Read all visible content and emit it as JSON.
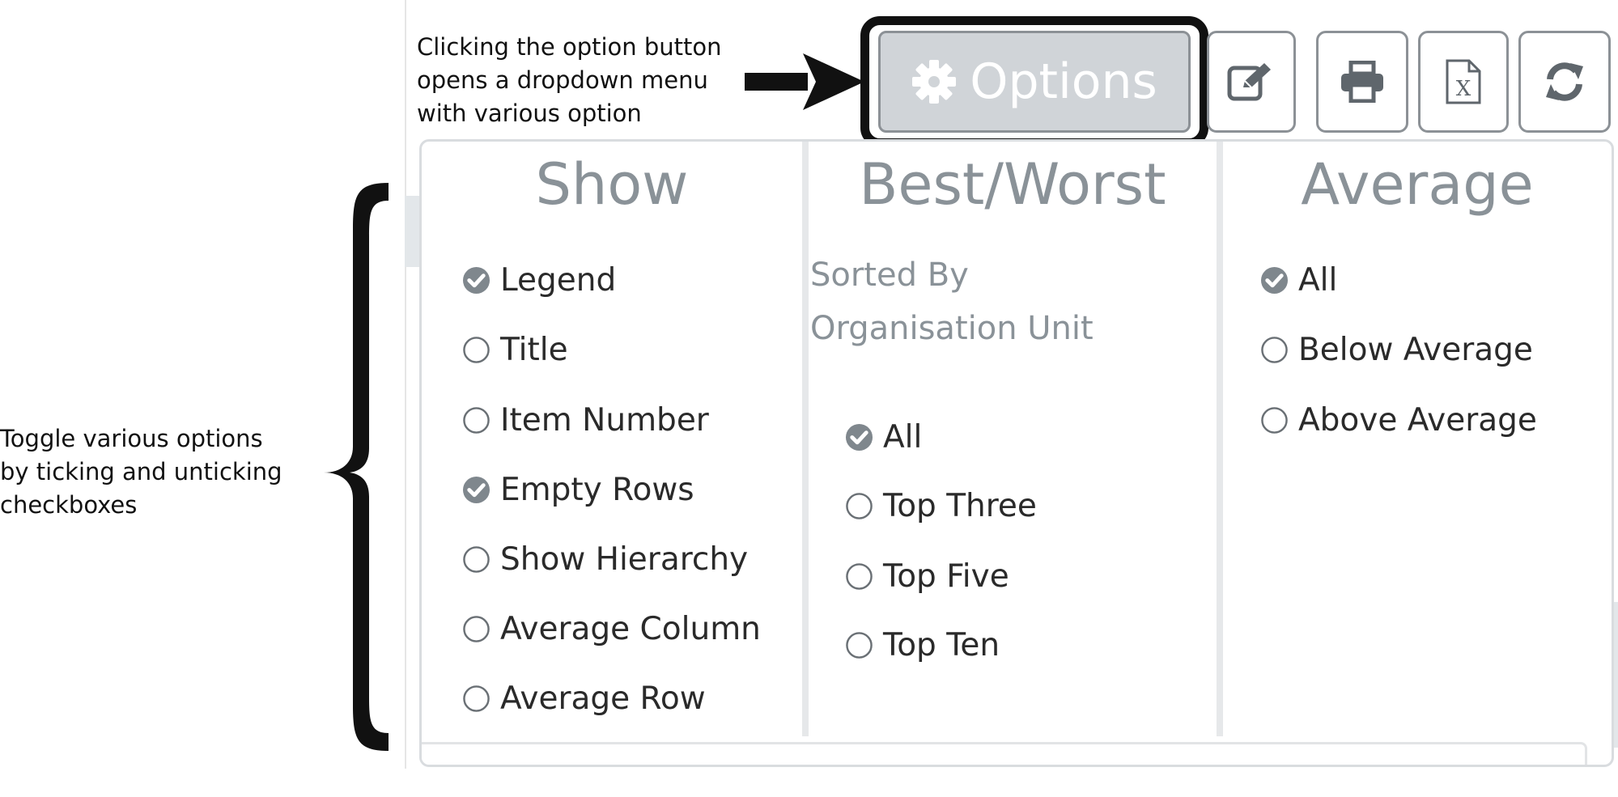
{
  "annotations": {
    "top": [
      "Clicking the option button",
      "opens a dropdown menu",
      "with various option"
    ],
    "left": [
      "Toggle various options",
      "by ticking and unticking",
      "checkboxes"
    ]
  },
  "toolbar": {
    "options_label": "Options",
    "options_icon": "gear-icon",
    "buttons": [
      {
        "name": "edit",
        "icon": "pencil-square-icon"
      },
      {
        "name": "print",
        "icon": "printer-icon"
      },
      {
        "name": "excel",
        "icon": "excel-file-icon",
        "glyph": "X"
      },
      {
        "name": "refresh",
        "icon": "refresh-icon"
      }
    ]
  },
  "dropdown": {
    "show": {
      "title": "Show",
      "items": [
        {
          "label": "Legend",
          "checked": true
        },
        {
          "label": "Title",
          "checked": false
        },
        {
          "label": "Item Number",
          "checked": false
        },
        {
          "label": "Empty Rows",
          "checked": true
        },
        {
          "label": "Show Hierarchy",
          "checked": false
        },
        {
          "label": "Average Column",
          "checked": false
        },
        {
          "label": "Average Row",
          "checked": false
        }
      ]
    },
    "best_worst": {
      "title": "Best/Worst",
      "subtitle": [
        "Sorted By",
        "Organisation Unit"
      ],
      "items": [
        {
          "label": "All",
          "checked": true
        },
        {
          "label": "Top Three",
          "checked": false
        },
        {
          "label": "Top Five",
          "checked": false
        },
        {
          "label": "Top Ten",
          "checked": false
        }
      ]
    },
    "average": {
      "title": "Average",
      "items": [
        {
          "label": "All",
          "checked": true
        },
        {
          "label": "Below Average",
          "checked": false
        },
        {
          "label": "Above Average",
          "checked": false
        }
      ]
    }
  },
  "colors": {
    "accent_gray": "#8a9298",
    "options_button_bg": "#d0d4d8",
    "checked_fill": "#7f878d",
    "annotation_black": "#111111"
  }
}
